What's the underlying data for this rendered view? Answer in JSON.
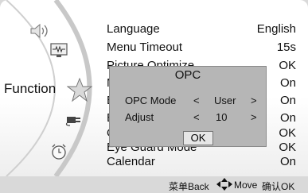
{
  "sidebar": {
    "function_label": "Function"
  },
  "menu": {
    "items": [
      {
        "label": "Language",
        "value": "English"
      },
      {
        "label": "Menu Timeout",
        "value": "15s"
      },
      {
        "label": "Picture Optimize",
        "value": "OK"
      },
      {
        "label": "M",
        "value": "On"
      },
      {
        "label": "B",
        "value": "On"
      },
      {
        "label": "B",
        "value": "On"
      },
      {
        "label": "O",
        "value": "OK"
      },
      {
        "label": "Eye Guard Mode",
        "value": "OK"
      },
      {
        "label": "Calendar",
        "value": "On"
      }
    ]
  },
  "dialog": {
    "title": "OPC",
    "rows": [
      {
        "label": "OPC Mode",
        "left_arrow": "<",
        "value": "User",
        "right_arrow": ">"
      },
      {
        "label": "Adjust",
        "left_arrow": "<",
        "value": "10",
        "right_arrow": ">"
      }
    ],
    "ok_label": "OK"
  },
  "footer": {
    "back_label": "菜单Back",
    "move_label": "Move",
    "ok_label": "确认OK"
  }
}
